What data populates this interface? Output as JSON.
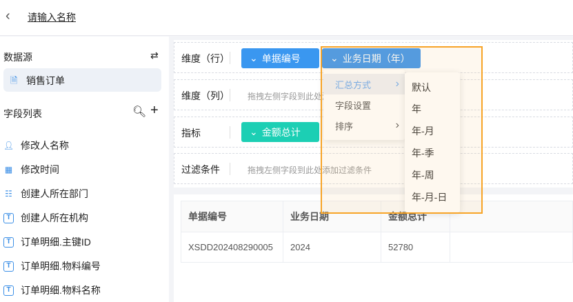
{
  "header": {
    "title": "请输入名称"
  },
  "sidebar": {
    "datasource_label": "数据源",
    "datasource_item": "销售订单",
    "fields_label": "字段列表",
    "fields": [
      {
        "label": "修改人名称",
        "icon": "user-icon"
      },
      {
        "label": "修改时间",
        "icon": "calendar-icon"
      },
      {
        "label": "创建人所在部门",
        "icon": "org-icon"
      },
      {
        "label": "创建人所在机构",
        "icon": "text-icon"
      },
      {
        "label": "订单明细.主键ID",
        "icon": "text-icon"
      },
      {
        "label": "订单明细.物料编号",
        "icon": "text-icon"
      },
      {
        "label": "订单明细.物料名称",
        "icon": "text-icon"
      }
    ]
  },
  "config": {
    "rows_label": "维度（行）",
    "cols_label": "维度（列）",
    "metrics_label": "指标",
    "filter_label": "过滤条件",
    "cols_hint": "拖拽左侧字段到此处添加维度",
    "filter_hint": "拖拽左侧字段到此处添加过滤条件",
    "row_pills": [
      "单据编号",
      "业务日期（年）"
    ],
    "metric_pill": "金额总计"
  },
  "colors": {
    "blue": "#3a97f0",
    "teal": "#1ccfb4",
    "highlight": "#f7a325"
  },
  "menu": {
    "items": [
      "汇总方式",
      "字段设置",
      "排序"
    ],
    "submenu": [
      "默认",
      "年",
      "年-月",
      "年-季",
      "年-周",
      "年-月-日"
    ]
  },
  "table": {
    "headers": [
      "单据编号",
      "业务日期",
      "金额总计"
    ],
    "rows": [
      [
        "XSDD202408290005",
        "2024",
        "52780"
      ]
    ]
  }
}
